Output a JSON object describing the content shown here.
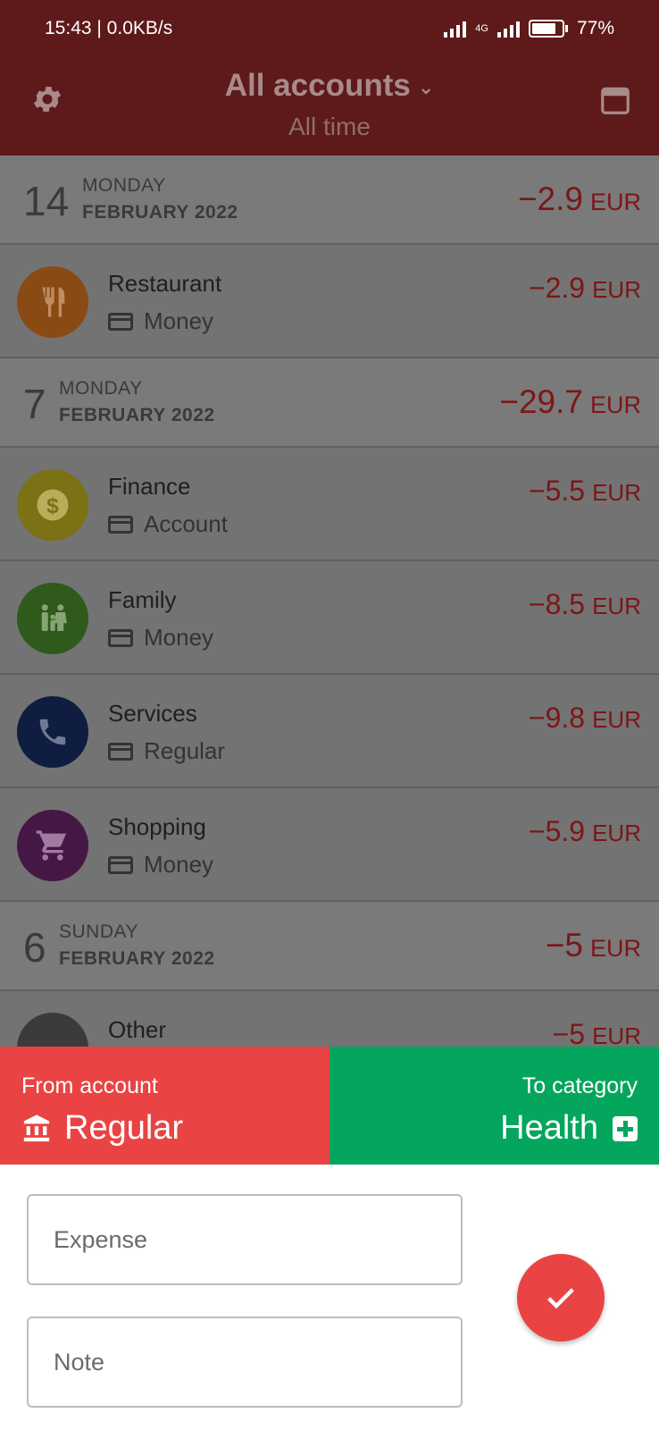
{
  "status_bar": {
    "time": "15:43 | 0.0KB/s",
    "network": "4G",
    "battery": "77%"
  },
  "app_bar": {
    "title": "All accounts",
    "subtitle": "All time"
  },
  "groups": [
    {
      "day": "14",
      "weekday": "MONDAY",
      "month_year": "FEBRUARY 2022",
      "total": "−2.9",
      "currency": "EUR",
      "items": [
        {
          "category": "Restaurant",
          "account": "Money",
          "amount": "−2.9",
          "currency": "EUR",
          "color": "#8a4a14",
          "icon": "restaurant-icon"
        }
      ]
    },
    {
      "day": "7",
      "weekday": "MONDAY",
      "month_year": "FEBRUARY 2022",
      "total": "−29.7",
      "currency": "EUR",
      "items": [
        {
          "category": "Finance",
          "account": "Account",
          "amount": "−5.5",
          "currency": "EUR",
          "color": "#7a7214",
          "icon": "dollar-coin-icon"
        },
        {
          "category": "Family",
          "account": "Money",
          "amount": "−8.5",
          "currency": "EUR",
          "color": "#2f5a1c",
          "icon": "family-icon"
        },
        {
          "category": "Services",
          "account": "Regular",
          "amount": "−9.8",
          "currency": "EUR",
          "color": "#0f1d40",
          "icon": "phone-icon"
        },
        {
          "category": "Shopping",
          "account": "Money",
          "amount": "−5.9",
          "currency": "EUR",
          "color": "#451744",
          "icon": "cart-icon"
        }
      ]
    },
    {
      "day": "6",
      "weekday": "SUNDAY",
      "month_year": "FEBRUARY 2022",
      "total": "−5",
      "currency": "EUR",
      "items": [
        {
          "category": "Other",
          "account": "",
          "amount": "−5",
          "currency": "EUR",
          "color": "#3b3b3b",
          "icon": "other-icon"
        }
      ]
    }
  ],
  "transfer": {
    "from_label": "From account",
    "from_value": "Regular",
    "from_color": "#ea4343",
    "to_label": "To category",
    "to_value": "Health",
    "to_color": "#04a65d"
  },
  "form": {
    "expense_placeholder": "Expense",
    "note_placeholder": "Note"
  }
}
